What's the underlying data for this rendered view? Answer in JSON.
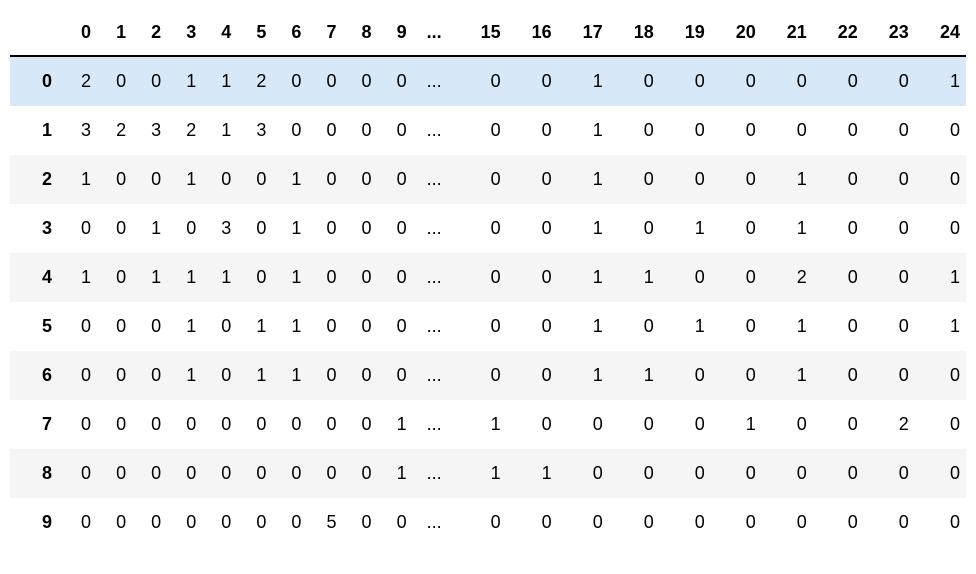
{
  "table": {
    "columns": [
      "0",
      "1",
      "2",
      "3",
      "4",
      "5",
      "6",
      "7",
      "8",
      "9",
      "...",
      "15",
      "16",
      "17",
      "18",
      "19",
      "20",
      "21",
      "22",
      "23",
      "24"
    ],
    "rows": [
      {
        "label": "0",
        "highlight": true,
        "cells": [
          "2",
          "0",
          "0",
          "1",
          "1",
          "2",
          "0",
          "0",
          "0",
          "0",
          "...",
          "0",
          "0",
          "1",
          "0",
          "0",
          "0",
          "0",
          "0",
          "0",
          "1"
        ]
      },
      {
        "label": "1",
        "highlight": false,
        "cells": [
          "3",
          "2",
          "3",
          "2",
          "1",
          "3",
          "0",
          "0",
          "0",
          "0",
          "...",
          "0",
          "0",
          "1",
          "0",
          "0",
          "0",
          "0",
          "0",
          "0",
          "0"
        ]
      },
      {
        "label": "2",
        "highlight": false,
        "cells": [
          "1",
          "0",
          "0",
          "1",
          "0",
          "0",
          "1",
          "0",
          "0",
          "0",
          "...",
          "0",
          "0",
          "1",
          "0",
          "0",
          "0",
          "1",
          "0",
          "0",
          "0"
        ]
      },
      {
        "label": "3",
        "highlight": false,
        "cells": [
          "0",
          "0",
          "1",
          "0",
          "3",
          "0",
          "1",
          "0",
          "0",
          "0",
          "...",
          "0",
          "0",
          "1",
          "0",
          "1",
          "0",
          "1",
          "0",
          "0",
          "0"
        ]
      },
      {
        "label": "4",
        "highlight": false,
        "cells": [
          "1",
          "0",
          "1",
          "1",
          "1",
          "0",
          "1",
          "0",
          "0",
          "0",
          "...",
          "0",
          "0",
          "1",
          "1",
          "0",
          "0",
          "2",
          "0",
          "0",
          "1"
        ]
      },
      {
        "label": "5",
        "highlight": false,
        "cells": [
          "0",
          "0",
          "0",
          "1",
          "0",
          "1",
          "1",
          "0",
          "0",
          "0",
          "...",
          "0",
          "0",
          "1",
          "0",
          "1",
          "0",
          "1",
          "0",
          "0",
          "1"
        ]
      },
      {
        "label": "6",
        "highlight": false,
        "cells": [
          "0",
          "0",
          "0",
          "1",
          "0",
          "1",
          "1",
          "0",
          "0",
          "0",
          "...",
          "0",
          "0",
          "1",
          "1",
          "0",
          "0",
          "1",
          "0",
          "0",
          "0"
        ]
      },
      {
        "label": "7",
        "highlight": false,
        "cells": [
          "0",
          "0",
          "0",
          "0",
          "0",
          "0",
          "0",
          "0",
          "0",
          "1",
          "...",
          "1",
          "0",
          "0",
          "0",
          "0",
          "1",
          "0",
          "0",
          "2",
          "0"
        ]
      },
      {
        "label": "8",
        "highlight": false,
        "cells": [
          "0",
          "0",
          "0",
          "0",
          "0",
          "0",
          "0",
          "0",
          "0",
          "1",
          "...",
          "1",
          "1",
          "0",
          "0",
          "0",
          "0",
          "0",
          "0",
          "0",
          "0"
        ]
      },
      {
        "label": "9",
        "highlight": false,
        "cells": [
          "0",
          "0",
          "0",
          "0",
          "0",
          "0",
          "0",
          "5",
          "0",
          "0",
          "...",
          "0",
          "0",
          "0",
          "0",
          "0",
          "0",
          "0",
          "0",
          "0",
          "0"
        ]
      }
    ]
  }
}
